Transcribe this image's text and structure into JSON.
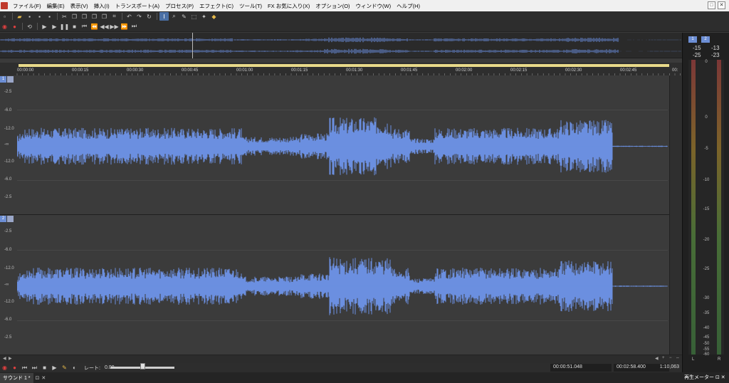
{
  "menu": {
    "items": [
      "ファイル(F)",
      "編集(E)",
      "表示(V)",
      "挿入(I)",
      "トランスポート(A)",
      "プロセス(P)",
      "エフェクト(C)",
      "ツール(T)",
      "FX お気に入り(X)",
      "オプション(O)",
      "ウィンドウ(W)",
      "ヘルプ(H)"
    ],
    "restore": "□",
    "close": "✕"
  },
  "timeline": {
    "labels": [
      "00:00:00",
      "00:00:15",
      "00:00:30",
      "00:00:45",
      "00:01:00",
      "00:01:15",
      "00:01:30",
      "00:01:45",
      "00:02:00",
      "00:02:15",
      "00:02:30",
      "00:02:45",
      "00:"
    ]
  },
  "tracks": [
    {
      "number": "1",
      "db_labels": [
        "-2.5",
        "-6.0",
        "-12.0",
        "-∞",
        "-12.0",
        "-6.0",
        "-2.5"
      ]
    },
    {
      "number": "2",
      "db_labels": [
        "-2.5",
        "-6.0",
        "-12.0",
        "-∞",
        "-12.0",
        "-6.0",
        "-2.5"
      ]
    }
  ],
  "transport": {
    "rate_label": "レート:",
    "rate_value": "0.00",
    "rate_level": 0.5,
    "cursor_time": "00:00:51.048",
    "length_time": "00:02:58.400",
    "zoom": "1:10,063"
  },
  "tabs": {
    "sound": "サウンド 1 *",
    "meter": "再生メーター"
  },
  "meter": {
    "btn1": "1",
    "btn2": "2",
    "peak_l_top": "-15",
    "peak_r_top": "-13",
    "peak_l_bottom": "-25",
    "peak_r_bottom": "-23",
    "scale": [
      "0",
      "0",
      "-5",
      "-10",
      "-15",
      "-20",
      "-25",
      "-30",
      "-35",
      "-40",
      "-45",
      "-50",
      "-55",
      "-60"
    ],
    "left": "L",
    "right": "R"
  },
  "colors": {
    "waveform": "#6b8fe0",
    "background": "#3b3b3b",
    "selection": "#e8d98a"
  }
}
